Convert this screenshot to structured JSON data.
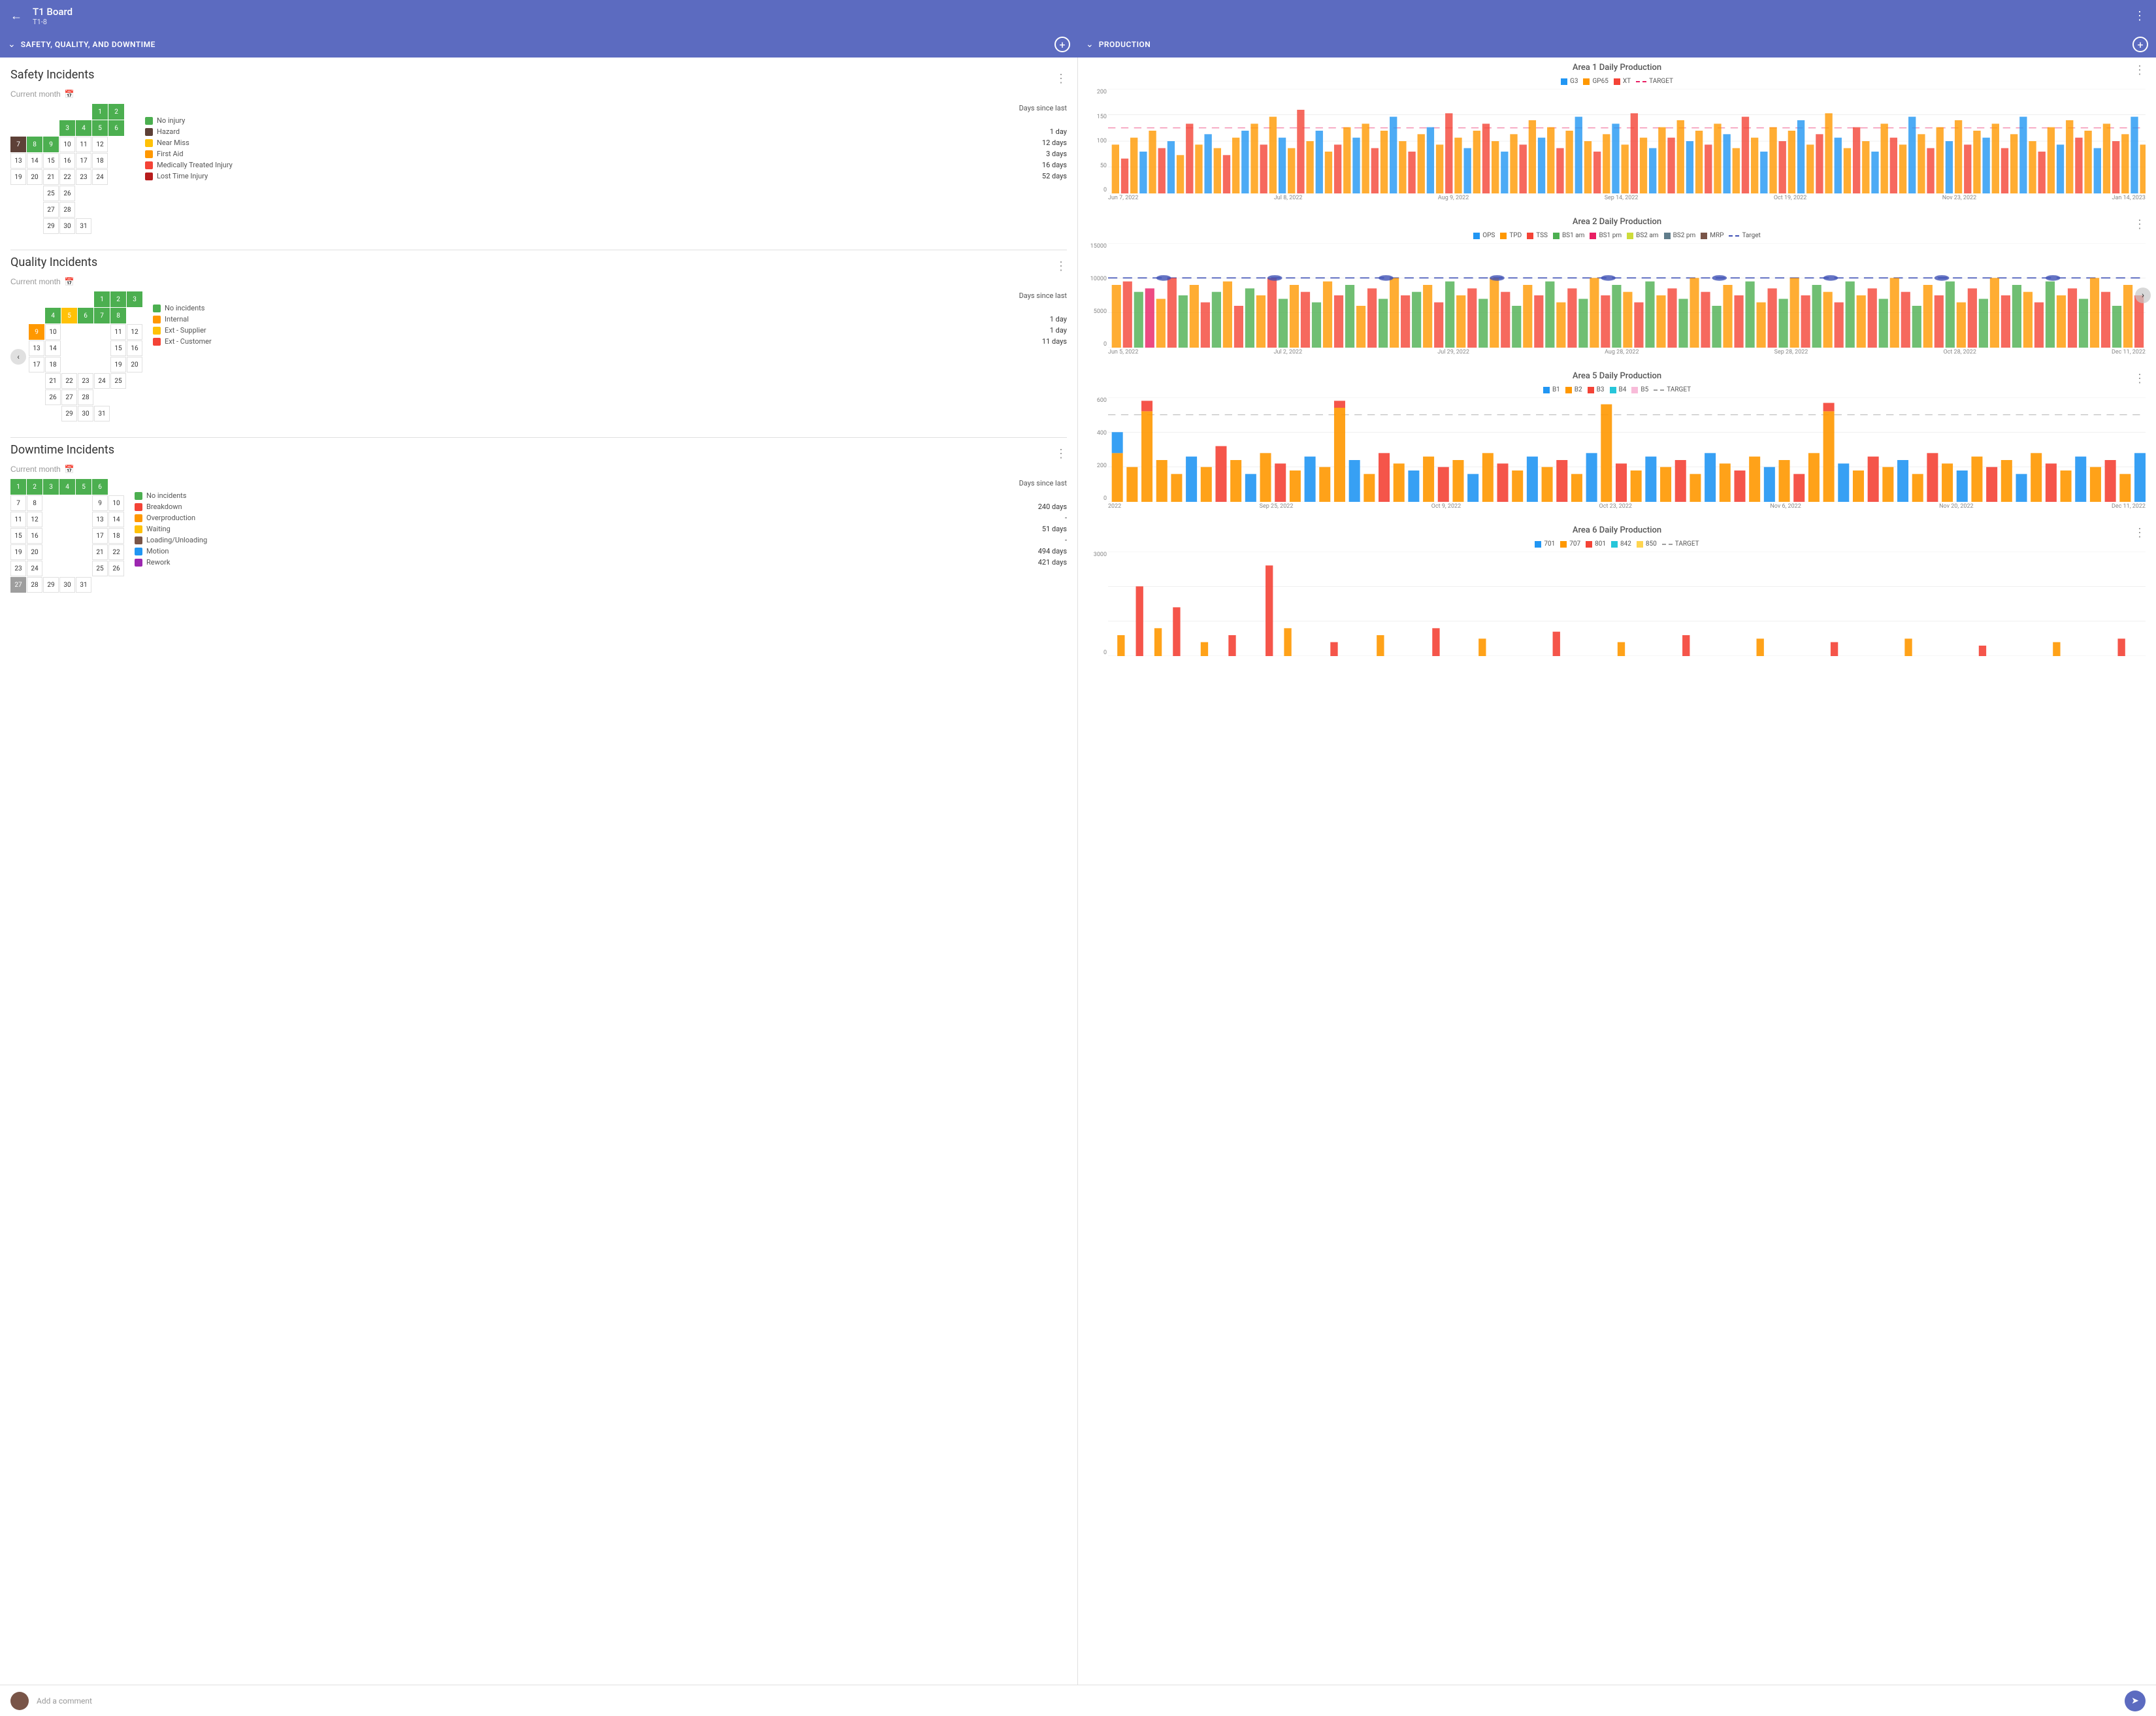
{
  "topbar": {
    "title": "T1 Board",
    "subtitle": "T1-8",
    "back_label": "←",
    "menu_label": "⋮"
  },
  "sections": {
    "left_label": "SAFETY, QUALITY, AND DOWNTIME",
    "right_label": "PRODUCTION"
  },
  "safety": {
    "title": "Safety Incidents",
    "current_month": "Current month",
    "days_since_last": "Days since last",
    "legend": [
      {
        "label": "No injury",
        "color": "#4caf50",
        "days": ""
      },
      {
        "label": "Hazard",
        "color": "#5d4037",
        "days": "1 day"
      },
      {
        "label": "Near Miss",
        "color": "#ffc107",
        "days": "12 days"
      },
      {
        "label": "First Aid",
        "color": "#ff9800",
        "days": "3 days"
      },
      {
        "label": "Medically Treated Injury",
        "color": "#f44336",
        "days": "16 days"
      },
      {
        "label": "Lost Time Injury",
        "color": "#b71c1c",
        "days": "52 days"
      }
    ]
  },
  "quality": {
    "title": "Quality Incidents",
    "current_month": "Current month",
    "days_since_last": "Days since last",
    "legend": [
      {
        "label": "No incidents",
        "color": "#4caf50",
        "days": ""
      },
      {
        "label": "Internal",
        "color": "#ff9800",
        "days": "1 day"
      },
      {
        "label": "Ext - Supplier",
        "color": "#ffc107",
        "days": "1 day"
      },
      {
        "label": "Ext - Customer",
        "color": "#f44336",
        "days": "11 days"
      }
    ]
  },
  "downtime": {
    "title": "Downtime Incidents",
    "current_month": "Current month",
    "days_since_last": "Days since last",
    "legend": [
      {
        "label": "No incidents",
        "color": "#4caf50",
        "days": ""
      },
      {
        "label": "Breakdown",
        "color": "#f44336",
        "days": "240 days"
      },
      {
        "label": "Overproduction",
        "color": "#ff9800",
        "days": "-"
      },
      {
        "label": "Waiting",
        "color": "#ffc107",
        "days": "51 days"
      },
      {
        "label": "Loading/Unloading",
        "color": "#795548",
        "days": "-"
      },
      {
        "label": "Motion",
        "color": "#2196f3",
        "days": "494 days"
      },
      {
        "label": "Rework",
        "color": "#9c27b0",
        "days": "421 days"
      }
    ]
  },
  "production": {
    "area1": {
      "title": "Area 1 Daily Production",
      "legend": [
        {
          "label": "G3",
          "color": "#2196f3",
          "dashed": false
        },
        {
          "label": "GP65",
          "color": "#ff9800",
          "dashed": false
        },
        {
          "label": "XT",
          "color": "#f44336",
          "dashed": false
        },
        {
          "label": "TARGET",
          "color": "#e91e63",
          "dashed": true
        }
      ],
      "y_labels": [
        "200",
        "150",
        "100",
        "50",
        "0"
      ],
      "x_labels": [
        "Jun 7, 2022",
        "Jul 8, 2022",
        "Aug 9, 2022",
        "Sep 14, 2022",
        "Oct 19, 2022",
        "Nov 23, 2022",
        "Jan 14, 2023"
      ]
    },
    "area2": {
      "title": "Area 2 Daily Production",
      "legend": [
        {
          "label": "OPS",
          "color": "#2196f3",
          "dashed": false
        },
        {
          "label": "TPD",
          "color": "#ff9800",
          "dashed": false
        },
        {
          "label": "TSS",
          "color": "#f44336",
          "dashed": false
        },
        {
          "label": "BS1 am",
          "color": "#4caf50",
          "dashed": false
        },
        {
          "label": "BS1 pm",
          "color": "#e91e63",
          "dashed": false
        },
        {
          "label": "BS2 am",
          "color": "#cddc39",
          "dashed": false
        },
        {
          "label": "BS2 pm",
          "color": "#607d8b",
          "dashed": false
        },
        {
          "label": "MRP",
          "color": "#795548",
          "dashed": false
        },
        {
          "label": "Target",
          "color": "#3f51b5",
          "dashed": true
        }
      ],
      "y_labels": [
        "15000",
        "10000",
        "5000",
        "0"
      ],
      "x_labels": [
        "Jun 5, 2022",
        "Jul 2, 2022",
        "Jul 29, 2022",
        "Aug 28, 2022",
        "Sep 28, 2022",
        "Oct 28, 2022",
        "Dec 11, 2022"
      ]
    },
    "area5": {
      "title": "Area 5 Daily Production",
      "legend": [
        {
          "label": "B1",
          "color": "#2196f3",
          "dashed": false
        },
        {
          "label": "B2",
          "color": "#ff9800",
          "dashed": false
        },
        {
          "label": "B3",
          "color": "#f44336",
          "dashed": false
        },
        {
          "label": "B4",
          "color": "#26c6da",
          "dashed": false
        },
        {
          "label": "B5",
          "color": "#f8bbd9",
          "dashed": false
        },
        {
          "label": "TARGET",
          "color": "#9e9e9e",
          "dashed": true
        }
      ],
      "y_labels": [
        "600",
        "400",
        "200",
        "0"
      ],
      "x_labels": [
        "2022",
        "Sep 25, 2022",
        "Oct 9, 2022",
        "Oct 23, 2022",
        "Nov 6, 2022",
        "Nov 20, 2022",
        "Dec 11, 2022"
      ]
    },
    "area6": {
      "title": "Area 6 Daily Production",
      "legend": [
        {
          "label": "701",
          "color": "#2196f3",
          "dashed": false
        },
        {
          "label": "707",
          "color": "#ff9800",
          "dashed": false
        },
        {
          "label": "801",
          "color": "#f44336",
          "dashed": false
        },
        {
          "label": "842",
          "color": "#26c6da",
          "dashed": false
        },
        {
          "label": "850",
          "color": "#ffd54f",
          "dashed": false
        },
        {
          "label": "TARGET",
          "color": "#9e9e9e",
          "dashed": true
        }
      ],
      "y_labels": [
        "3000",
        "",
        "",
        "0"
      ]
    }
  },
  "comments": {
    "add_comment": "Add a comment"
  }
}
